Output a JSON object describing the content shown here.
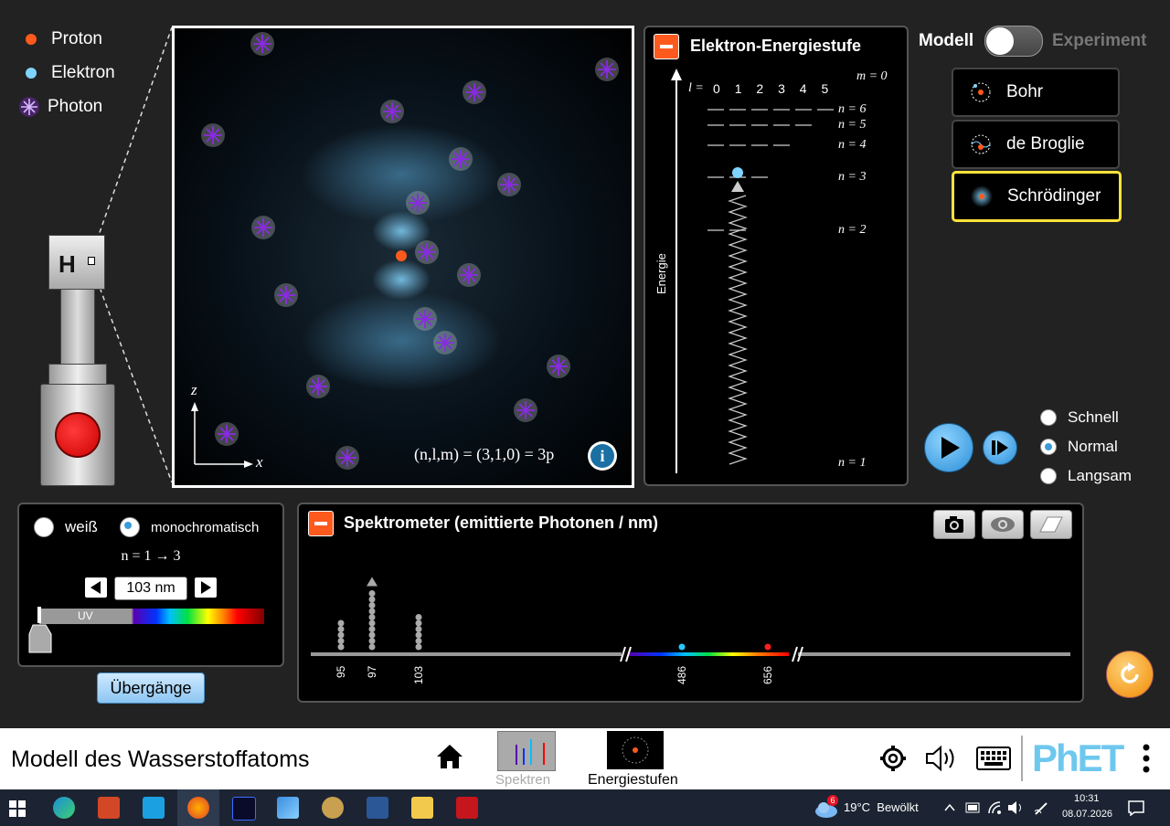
{
  "legend": {
    "proton": "Proton",
    "electron": "Elektron",
    "photon": "Photon"
  },
  "gun": {
    "label": "H"
  },
  "view": {
    "axis_z": "z",
    "axis_x": "x",
    "state_text": "(n,l,m) = (3,1,0) = 3p"
  },
  "energy": {
    "title": "Elektron-Energiestufe",
    "l_label": "l =",
    "l_values": [
      "0",
      "1",
      "2",
      "3",
      "4",
      "5"
    ],
    "m_label": "m = 0",
    "levels": [
      "n = 6",
      "n = 5",
      "n = 4",
      "n = 3",
      "n = 2",
      "n = 1"
    ],
    "axis_label": "Energie"
  },
  "toggle": {
    "left": "Modell",
    "right": "Experiment"
  },
  "models": [
    {
      "label": "Bohr",
      "selected": false
    },
    {
      "label": "de Broglie",
      "selected": false
    },
    {
      "label": "Schrödinger",
      "selected": true
    }
  ],
  "speed": {
    "options": [
      "Schnell",
      "Normal",
      "Langsam"
    ],
    "selected": "Normal"
  },
  "light": {
    "white_label": "weiß",
    "mono_label": "monochromatisch",
    "transition": "n = 1 → 3",
    "wavelength": "103 nm",
    "uv_label": "UV"
  },
  "transitions_button": "Übergänge",
  "spectrometer": {
    "title": "Spektrometer (emittierte Photonen / nm)",
    "ticks": [
      "95",
      "97",
      "103",
      "486",
      "656"
    ],
    "counts": {
      "95": 5,
      "97": 10,
      "103": 6,
      "486": 1,
      "656": 1
    }
  },
  "navbar": {
    "title": "Modell des Wasserstoffatoms",
    "screens": [
      "Spektren",
      "Energiestufen"
    ],
    "brand": "PhET"
  },
  "taskbar": {
    "weather_badge": "6",
    "weather": "19°C  Bewölkt",
    "time": "10:31",
    "date": "08.07.2026"
  },
  "colors": {
    "proton": "#ff5a1e",
    "electron": "#7fd4ff",
    "photon": "#8a2be2",
    "highlight": "#ffe33a",
    "accent": "#3a9bd8"
  }
}
